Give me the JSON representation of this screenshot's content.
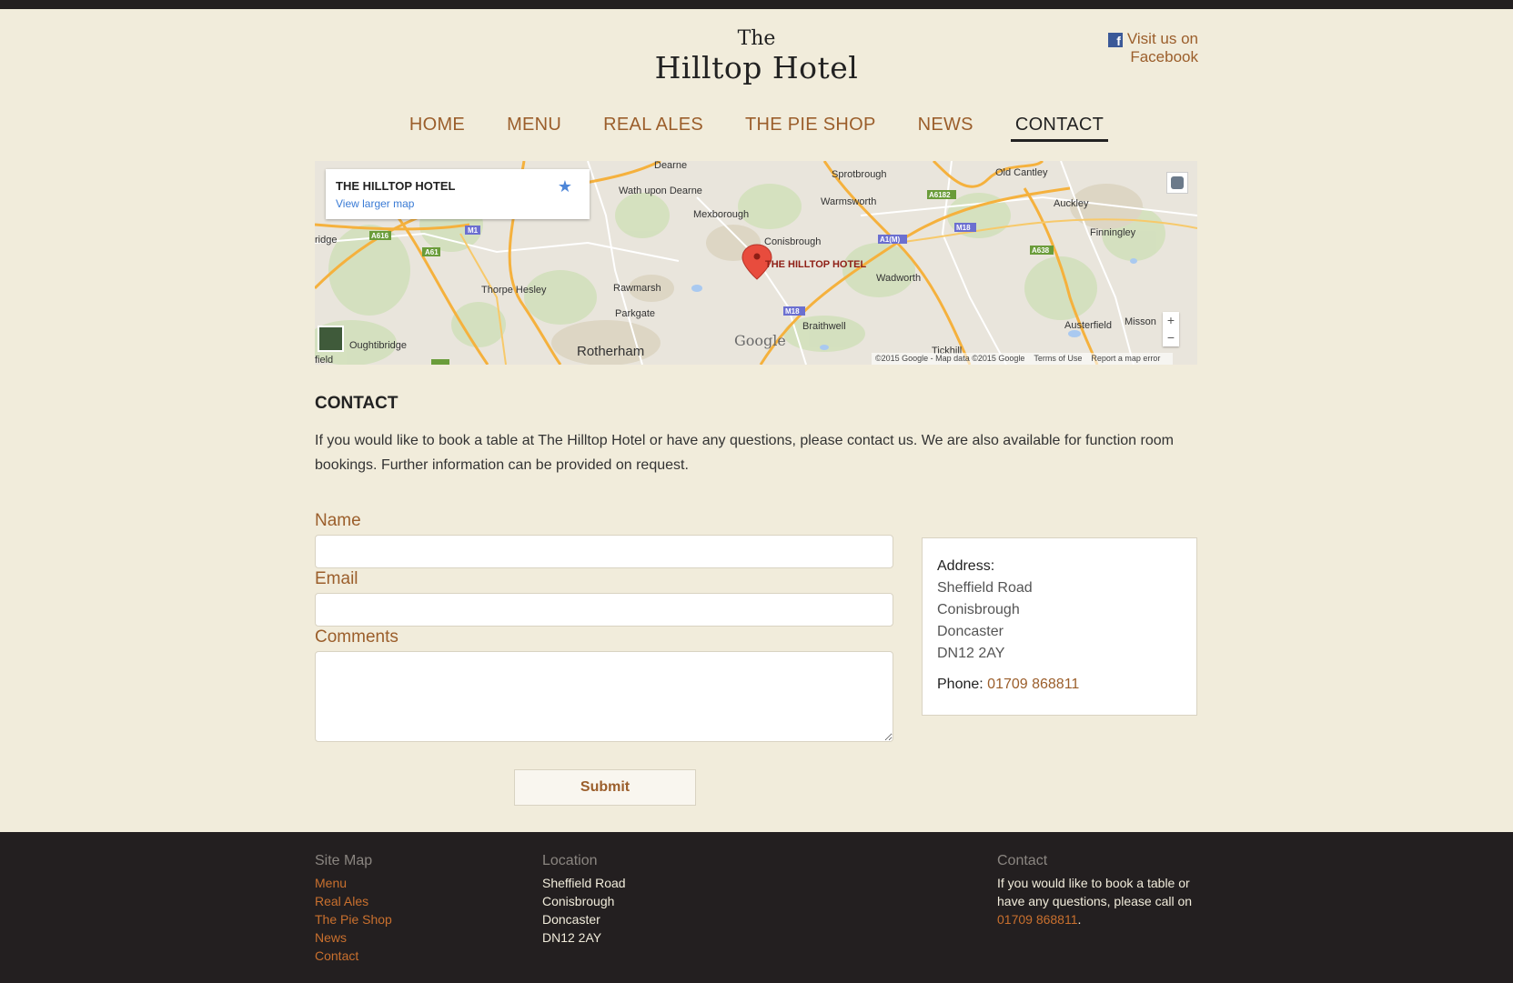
{
  "site": {
    "logo_top": "The",
    "logo_bottom": "Hilltop Hotel",
    "facebook_label": "Visit us on Facebook"
  },
  "nav": {
    "items": [
      "HOME",
      "MENU",
      "REAL ALES",
      "THE PIE SHOP",
      "NEWS",
      "CONTACT"
    ],
    "active": "CONTACT"
  },
  "map": {
    "info_title": "THE HILLTOP HOTEL",
    "info_link": "View larger map",
    "marker_label": "THE HILLTOP HOTEL",
    "places": [
      "Dearne",
      "Wath upon Dearne",
      "Sprotbrough",
      "Old Cantley",
      "Warmsworth",
      "Auckley",
      "Mexborough",
      "Conisbrough",
      "Finningley",
      "Wadworth",
      "Thorpe Hesley",
      "Rawmarsh",
      "Parkgate",
      "Braithwell",
      "Austerfield",
      "Misson",
      "Rotherham",
      "Oughtibridge",
      "Tickhill",
      "ridge",
      "field"
    ],
    "road_labels": [
      "A616",
      "M1",
      "A61",
      "A6182",
      "M18",
      "A1(M)",
      "A638",
      "M18",
      "A61"
    ],
    "google": "Google",
    "footer": [
      "©2015 Google - Map data ©2015 Google",
      "Terms of Use",
      "Report a map error"
    ],
    "zoom_in": "+",
    "zoom_out": "−"
  },
  "contact": {
    "heading": "CONTACT",
    "intro": "If you would like to book a table at The Hilltop Hotel or have any questions, please contact us. We are also available for function room bookings. Further information can be provided on request.",
    "name_label": "Name",
    "email_label": "Email",
    "comments_label": "Comments",
    "name_value": "",
    "email_value": "",
    "comments_value": "",
    "submit_label": "Submit",
    "address_label": "Address:",
    "address_lines": [
      "Sheffield Road",
      "Conisbrough",
      "Doncaster",
      "DN12 2AY"
    ],
    "phone_label": "Phone:",
    "phone_value": "01709 868811"
  },
  "footer": {
    "sitemap_title": "Site Map",
    "sitemap_links": [
      "Menu",
      "Real Ales",
      "The Pie Shop",
      "News",
      "Contact"
    ],
    "location_title": "Location",
    "location_lines": [
      "Sheffield Road",
      "Conisbrough",
      "Doncaster",
      "DN12 2AY"
    ],
    "contact_title": "Contact",
    "contact_text": "If you would like to book a table or have any questions, please call on",
    "contact_phone": "01709 868811",
    "contact_end": "."
  },
  "colors": {
    "background": "#f1ecdb",
    "accent": "#9b5e2b",
    "footer_bg": "#231f20",
    "footer_link": "#c9702e"
  }
}
